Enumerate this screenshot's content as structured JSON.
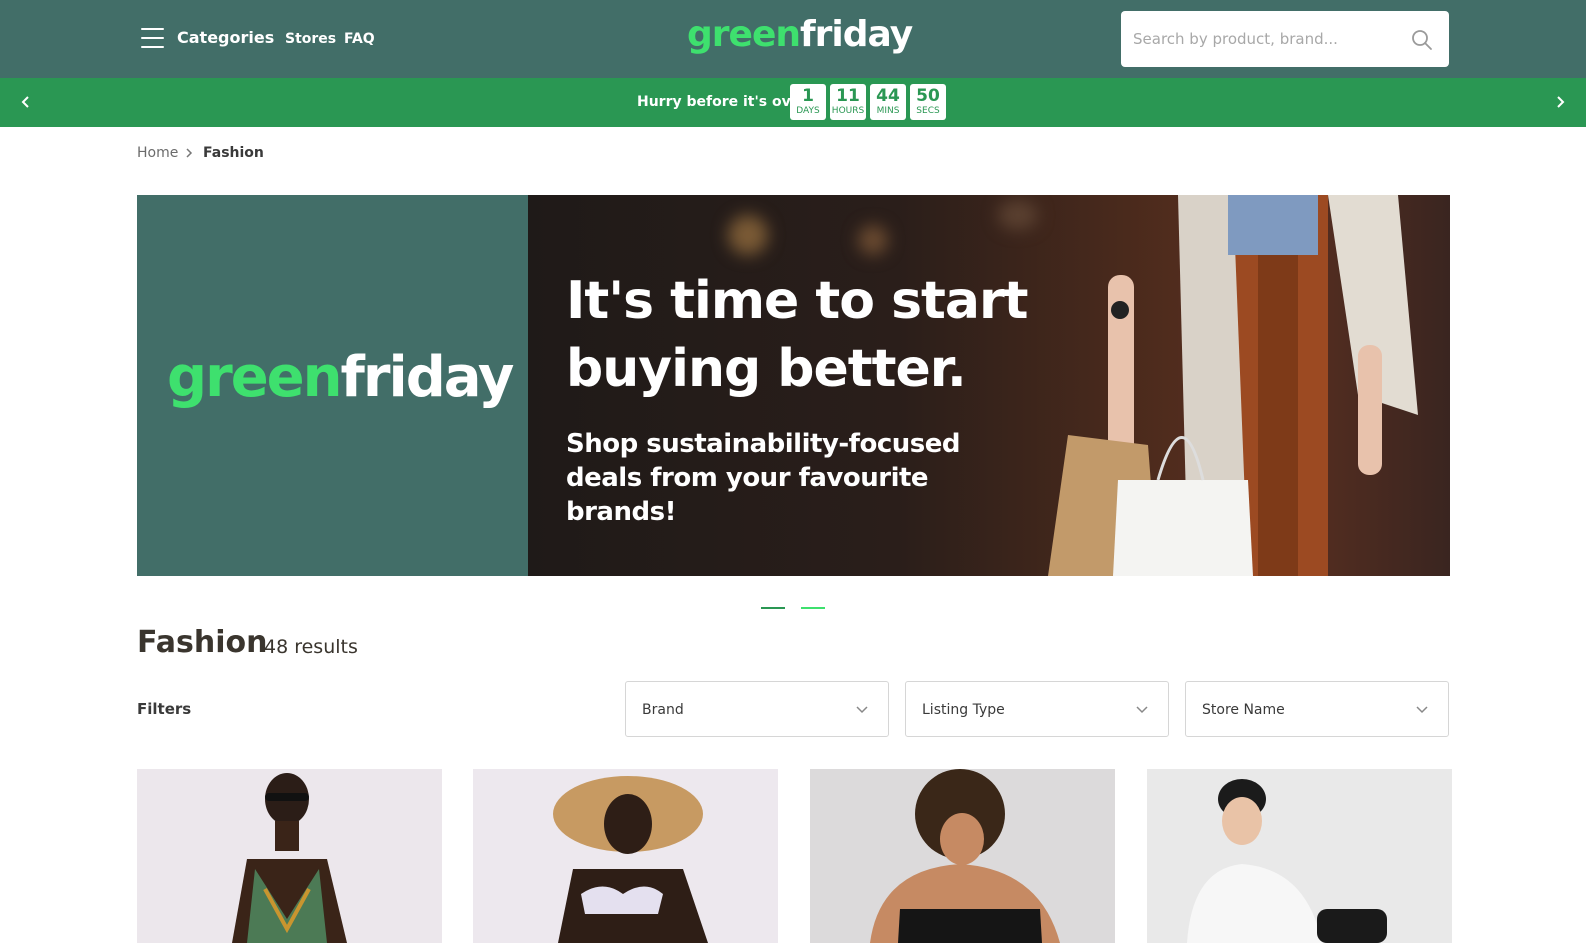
{
  "header": {
    "categories_label": "Categories",
    "links": [
      "Stores",
      "FAQ"
    ],
    "logo": {
      "part1": "green",
      "part2": "friday"
    },
    "search_placeholder": "Search by product, brand..."
  },
  "countdown": {
    "message": "Hurry before it's over!",
    "units": [
      {
        "value": "1",
        "label": "DAYS"
      },
      {
        "value": "11",
        "label": "HOURS"
      },
      {
        "value": "44",
        "label": "MINS"
      },
      {
        "value": "50",
        "label": "SECS"
      }
    ]
  },
  "breadcrumb": {
    "home": "Home",
    "current": "Fashion"
  },
  "hero": {
    "logo": {
      "part1": "green",
      "part2": "friday"
    },
    "headline": "It's time to start buying better.",
    "subline": "Shop sustainability-focused deals from your favourite brands!"
  },
  "listing": {
    "title": "Fashion",
    "results": "48 results",
    "filters_label": "Filters",
    "filters": [
      "Brand",
      "Listing Type",
      "Store Name"
    ]
  },
  "colors": {
    "nav_bg": "#426e68",
    "banner_bg": "#2a9753",
    "accent_green": "#3ee06e"
  }
}
